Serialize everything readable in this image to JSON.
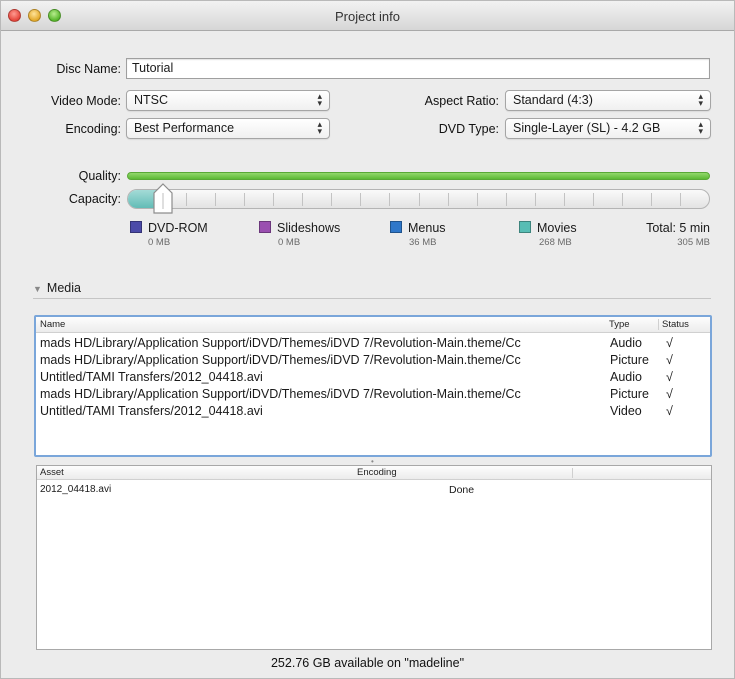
{
  "window": {
    "title": "Project info"
  },
  "form": {
    "disc_name_label": "Disc Name:",
    "disc_name_value": "Tutorial",
    "video_mode_label": "Video Mode:",
    "video_mode_value": "NTSC",
    "aspect_ratio_label": "Aspect Ratio:",
    "aspect_ratio_value": "Standard (4:3)",
    "encoding_label": "Encoding:",
    "encoding_value": "Best Performance",
    "dvd_type_label": "DVD Type:",
    "dvd_type_value": "Single-Layer (SL) - 4.2 GB"
  },
  "meters": {
    "quality_label": "Quality:",
    "capacity_label": "Capacity:",
    "capacity_fill_fraction": 0.072
  },
  "legend": [
    {
      "label": "DVD-ROM",
      "size": "0 MB",
      "color": "#4b4aa8"
    },
    {
      "label": "Slideshows",
      "size": "0 MB",
      "color": "#9a4fb0"
    },
    {
      "label": "Menus",
      "size": "36 MB",
      "color": "#2f77c9"
    },
    {
      "label": "Movies",
      "size": "268 MB",
      "color": "#58bdb4"
    }
  ],
  "total": {
    "label": "Total: 5 min",
    "size": "305 MB"
  },
  "media": {
    "section_label": "Media",
    "columns": {
      "name": "Name",
      "type": "Type",
      "status": "Status"
    },
    "rows": [
      {
        "name": "mads HD/Library/Application Support/iDVD/Themes/iDVD 7/Revolution-Main.theme/Cc",
        "type": "Audio",
        "status": "√"
      },
      {
        "name": "mads HD/Library/Application Support/iDVD/Themes/iDVD 7/Revolution-Main.theme/Cc",
        "type": "Picture",
        "status": "√"
      },
      {
        "name": "Untitled/TAMI Transfers/2012_04418.avi",
        "type": "Audio",
        "status": "√"
      },
      {
        "name": "mads HD/Library/Application Support/iDVD/Themes/iDVD 7/Revolution-Main.theme/Cc",
        "type": "Picture",
        "status": "√"
      },
      {
        "name": "Untitled/TAMI Transfers/2012_04418.avi",
        "type": "Video",
        "status": "√"
      }
    ]
  },
  "assets": {
    "columns": {
      "asset": "Asset",
      "encoding": "Encoding"
    },
    "rows": [
      {
        "asset": "2012_04418.avi",
        "encoding": "Done"
      }
    ]
  },
  "footer": {
    "available": "252.76 GB available on \"madeline\""
  }
}
